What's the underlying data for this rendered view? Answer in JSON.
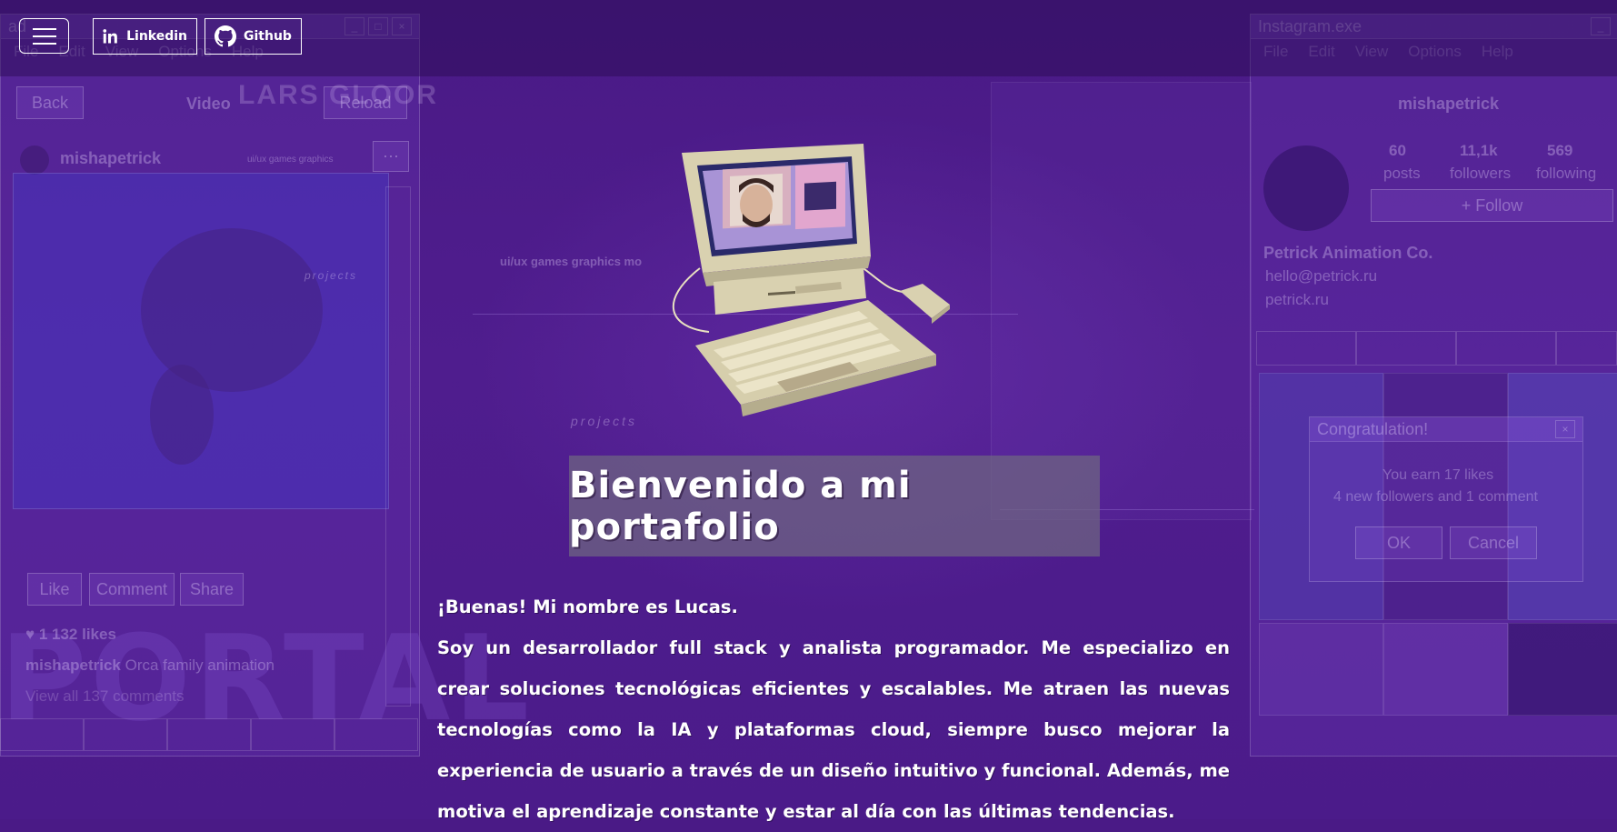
{
  "topbar": {
    "menu_label": "",
    "linkedin_label": "Linkedin",
    "github_label": "Github"
  },
  "background": {
    "left_window": {
      "title": "ad",
      "menu": [
        "File",
        "Edit",
        "View",
        "Options",
        "Help"
      ],
      "back_label": "Back",
      "video_label": "Video",
      "reload_label": "Reload",
      "logo_text": "LARS GLOOR",
      "username": "mishapetrick",
      "tags": "ui/ux  games  graphics",
      "projects_label": "projects",
      "like_label": "Like",
      "comment_label": "Comment",
      "share_label": "Share",
      "likes": "1 132 likes",
      "caption_user": "mishapetrick",
      "caption": "Orca family animation",
      "view_comments": "View all 137 comments",
      "portal_word": "PORTAL"
    },
    "center": {
      "tags": "ui/ux   games   graphics   mo",
      "projects_label": "projects"
    },
    "right_window": {
      "title": "Instagram.exe",
      "menu": [
        "File",
        "Edit",
        "View",
        "Options",
        "Help"
      ],
      "username": "mishapetrick",
      "stats": [
        {
          "value": "60",
          "label": "posts"
        },
        {
          "value": "11,1k",
          "label": "followers"
        },
        {
          "value": "569",
          "label": "following"
        }
      ],
      "follow_label": "+ Follow",
      "company": "Petrick Animation Co.",
      "email": "hello@petrick.ru",
      "site": "petrick.ru",
      "dialog": {
        "title": "Congratulation!",
        "line1": "You earn 17 likes",
        "line2": "4 new followers and 1 comment",
        "ok_label": "OK",
        "cancel_label": "Cancel"
      }
    }
  },
  "hero": {
    "title": "Bienvenido a mi portafolio",
    "greeting": "¡Buenas! Mi nombre es Lucas.",
    "bio": "Soy un desarrollador full stack y analista programador. Me especializo en crear soluciones tecnológicas eficientes y escalables. Me atraen las nuevas tecnologías como la IA y plataformas cloud, siempre busco mejorar la experiencia de usuario a través de un diseño intuitivo y funcional. Además, me motiva el aprendizaje constante y estar al día con las últimas tendencias."
  },
  "icons": [
    "menu-icon",
    "linkedin-icon",
    "github-icon",
    "computer-illustration"
  ]
}
